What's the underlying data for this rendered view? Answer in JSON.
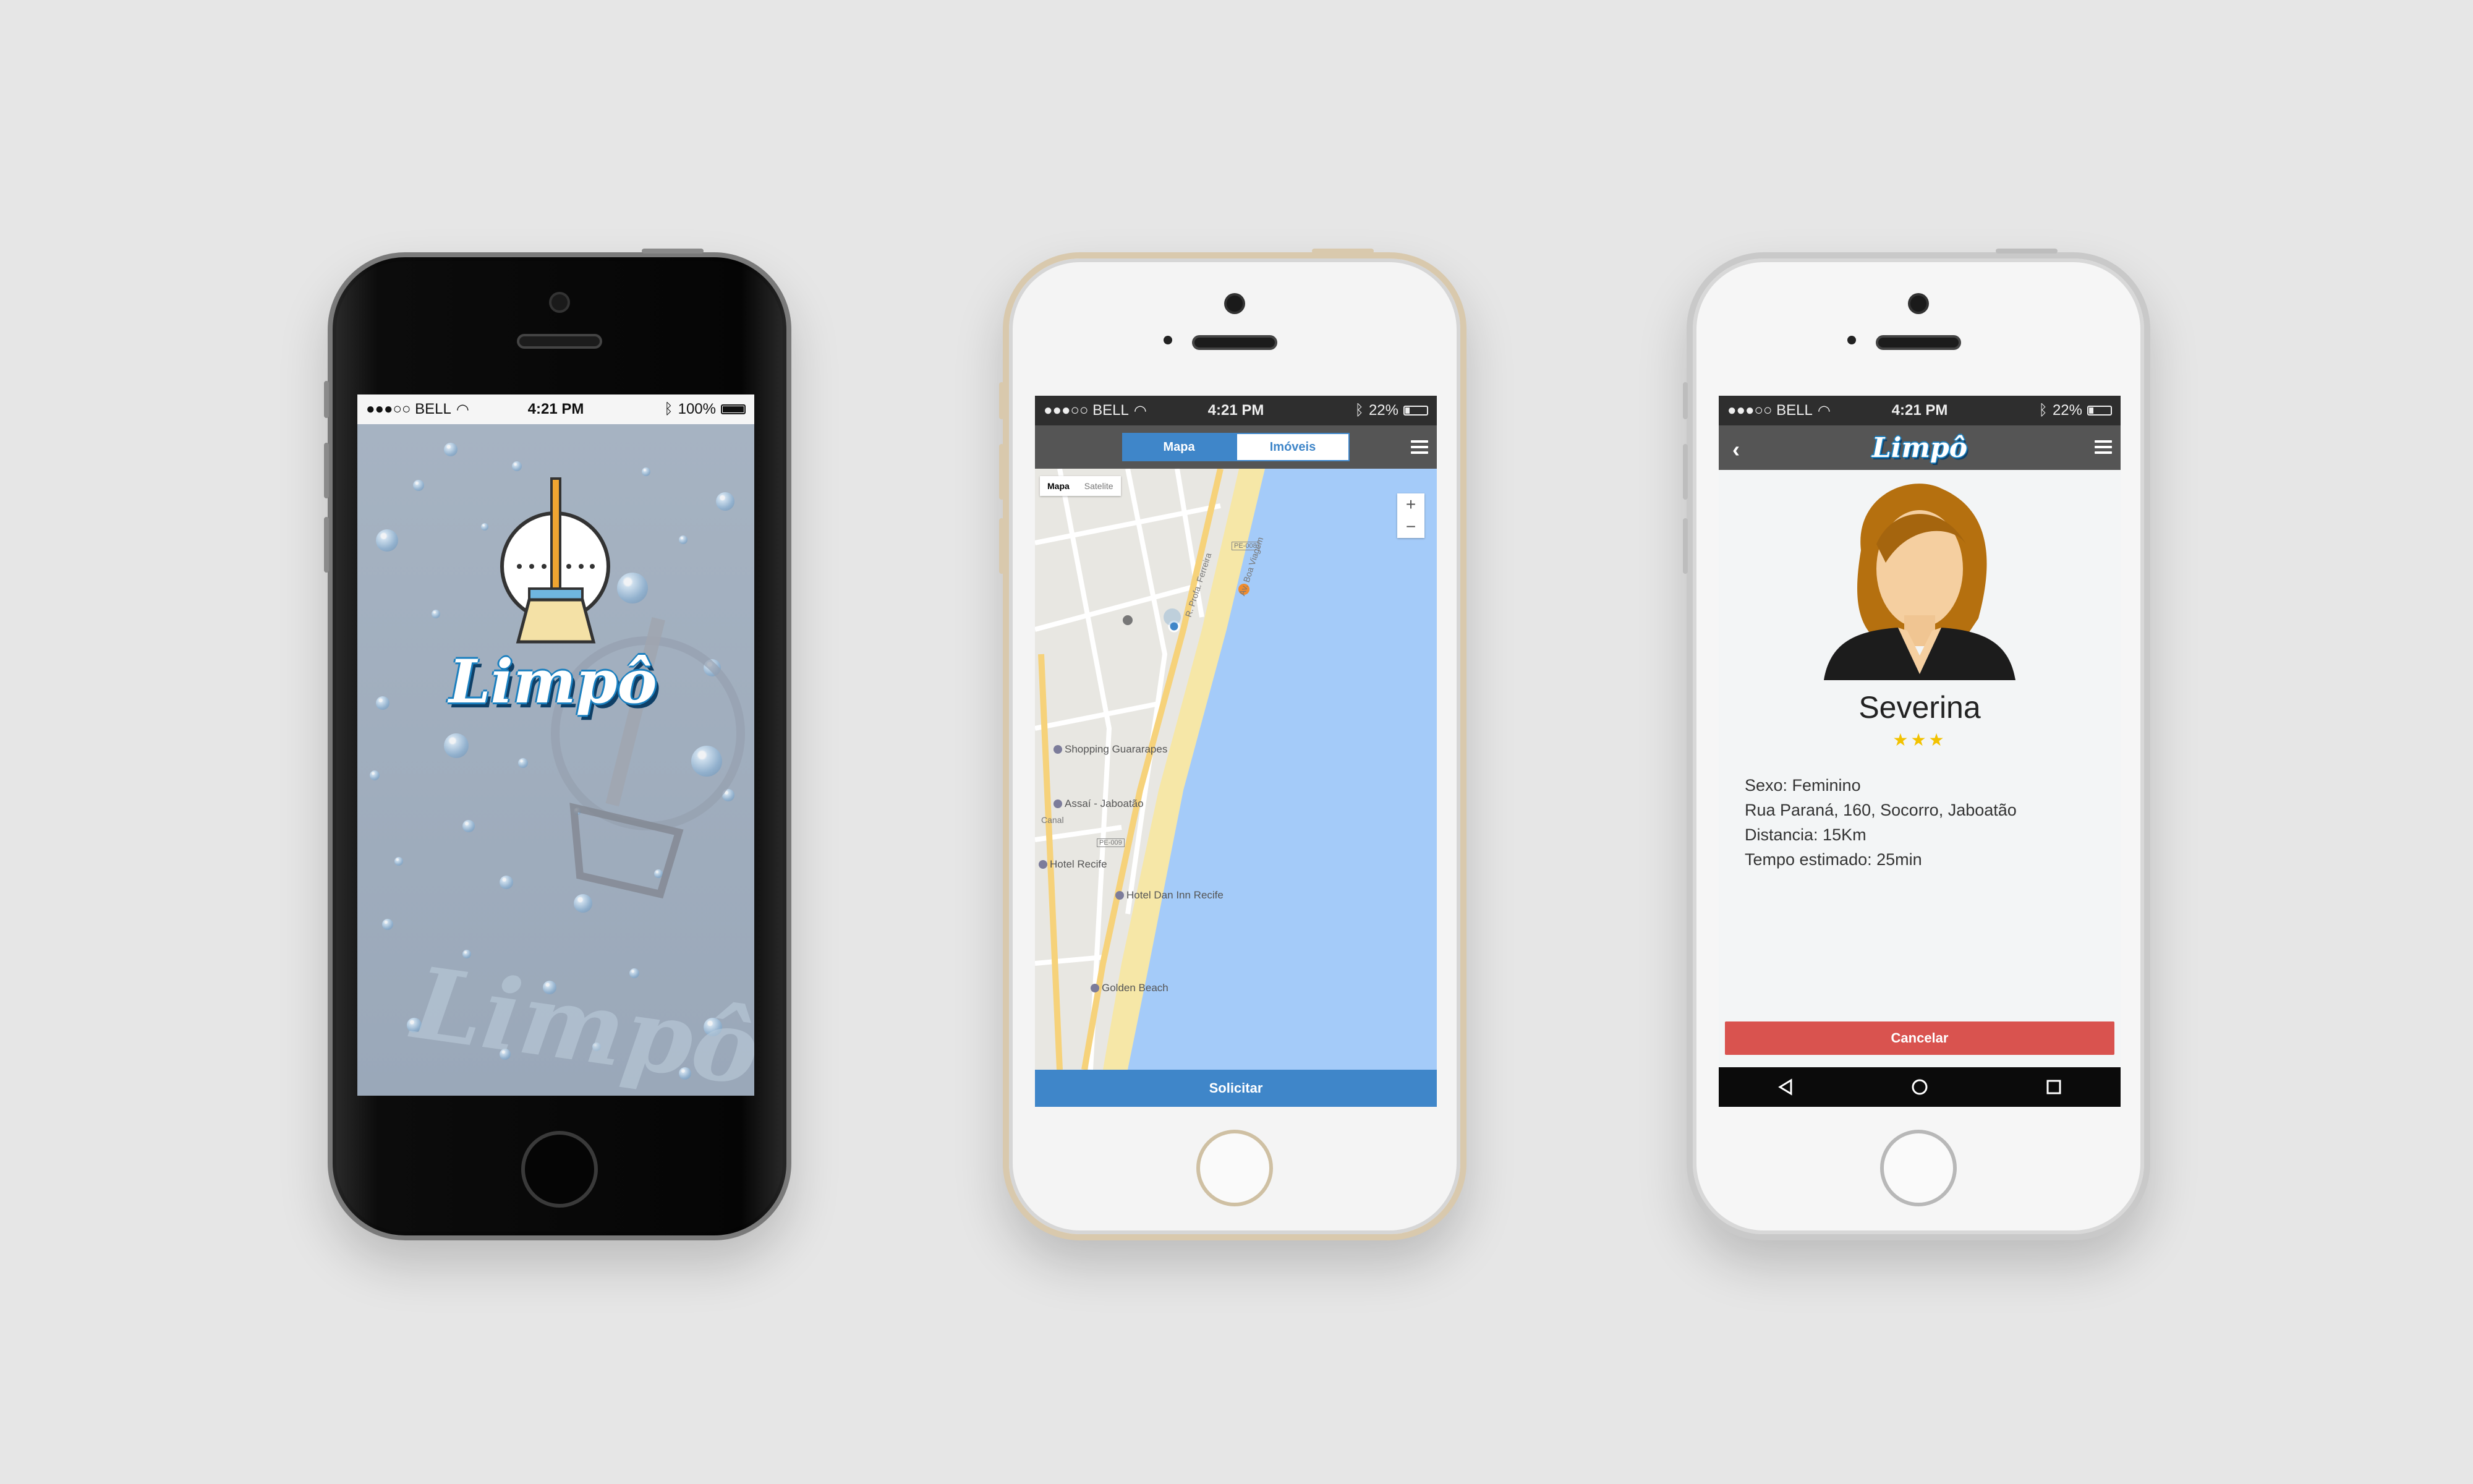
{
  "status_bar": {
    "carrier": "●●●○○ BELL",
    "time": "4:21 PM",
    "battery_left": "100%",
    "battery_right": "22%",
    "battery_left_level": 1.0,
    "battery_right_level": 0.22
  },
  "splash": {
    "logo_text": "Limpô",
    "ghost_text": "Limpô"
  },
  "map_screen": {
    "tabs": [
      {
        "label": "Mapa",
        "active": true
      },
      {
        "label": "Imóveis",
        "active": false
      }
    ],
    "map_type": {
      "map": "Mapa",
      "satellite": "Satelite"
    },
    "zoom_in": "+",
    "zoom_out": "−",
    "pois": [
      "Shopping Guararapes",
      "Assaí - Jaboatão",
      "Hotel Recife",
      "Hotel Dan Inn Recife",
      "Golden Beach"
    ],
    "streets": [
      "Av. Boa Viagem",
      "R. Profa. Ferreira",
      "PE-008",
      "PE-009",
      "Canal"
    ],
    "action_button": "Solicitar",
    "colors": {
      "water": "#a4cbf9",
      "beach": "#f6e7a7",
      "accent": "#3f86c9"
    }
  },
  "profile_screen": {
    "brand": "Limpô",
    "name": "Severina",
    "rating": "★★★",
    "details": [
      "Sexo: Feminino",
      "Rua Paraná, 160, Socorro, Jaboatão",
      "Distancia: 15Km",
      "Tempo estimado: 25min"
    ],
    "cancel_button": "Cancelar",
    "cancel_color": "#d9534f"
  }
}
